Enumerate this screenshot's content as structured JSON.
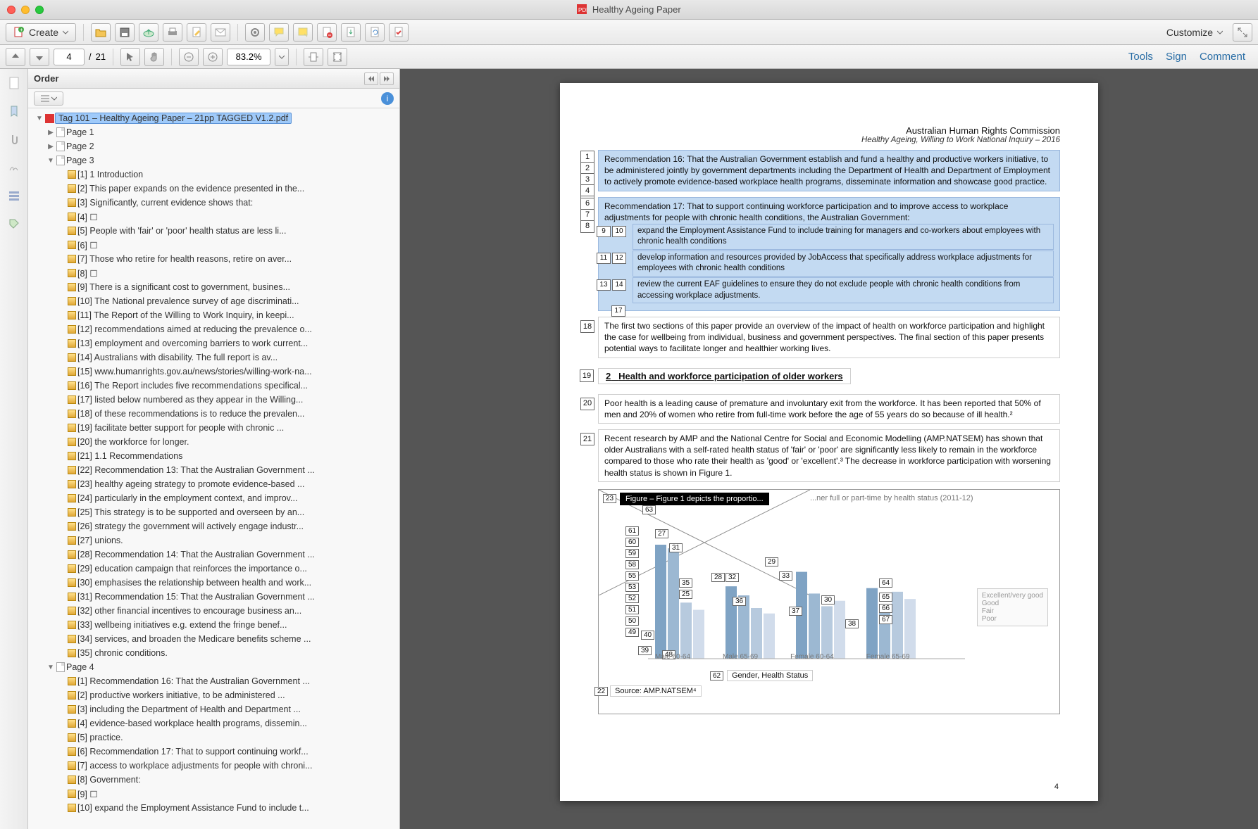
{
  "window_title": "Healthy Ageing Paper",
  "toolbar": {
    "create_label": "Create",
    "customize_label": "Customize"
  },
  "nav": {
    "page_current": "4",
    "page_sep": "/",
    "page_total": "21",
    "zoom": "83.2%",
    "tools": "Tools",
    "sign": "Sign",
    "comment": "Comment"
  },
  "order": {
    "title": "Order",
    "doc_name": "Tag 101 – Healthy Ageing Paper – 21pp TAGGED V1.2.pdf",
    "pages_simple": [
      "Page 1",
      "Page 2"
    ],
    "page3_label": "Page 3",
    "page3_items": [
      "[1]  1 Introduction",
      "[2]  This paper expands on the evidence presented in the...",
      "[3]  Significantly, current evidence shows that:",
      "[4]  ☐",
      "[5]  People with 'fair' or 'poor' health status are less li...",
      "[6]  ☐",
      "[7]  Those who retire for health reasons, retire on aver...",
      "[8]  ☐",
      "[9]  There is a significant cost to government, busines...",
      "[10]  The National prevalence survey of age discriminati...",
      "[11]  The Report of the Willing to Work Inquiry, in keepi...",
      "[12]  recommendations aimed at reducing the prevalence o...",
      "[13]  employment and overcoming barriers to work current...",
      "[14]  Australians with disability. The full report is av...",
      "[15]  www.humanrights.gov.au/news/stories/willing-work-na...",
      "[16]  The Report includes five recommendations specifical...",
      "[17]  listed below numbered as they appear in the Willing...",
      "[18]  of these recommendations is to reduce the prevalen...",
      "[19]  facilitate better support for people with chronic ...",
      "[20]  the workforce for longer.",
      "[21]  1.1 Recommendations",
      "[22]  Recommendation 13: That the Australian Government ...",
      "[23]  healthy ageing strategy to promote evidence-based ...",
      "[24]  particularly in the employment context, and improv...",
      "[25]  This strategy is to be supported and overseen by an...",
      "[26]  strategy the government will actively engage industr...",
      "[27]  unions.",
      "[28]  Recommendation 14: That the Australian Government ...",
      "[29]  education campaign that reinforces the importance o...",
      "[30]  emphasises the relationship between health and work...",
      "[31]  Recommendation 15: That the Australian Government ...",
      "[32]  other financial incentives to encourage business an...",
      "[33]  wellbeing initiatives e.g. extend the fringe benef...",
      "[34]  services, and broaden the Medicare benefits scheme ...",
      "[35]  chronic conditions."
    ],
    "page4_label": "Page 4",
    "page4_items": [
      "[1]  Recommendation 16: That the Australian Government ...",
      "[2]  productive workers initiative, to be administered ...",
      "[3]  including the Department of Health and Department ...",
      "[4]  evidence-based workplace health programs, dissemin...",
      "[5]  practice.",
      "[6]  Recommendation 17: That to support continuing workf...",
      "[7]  access to workplace adjustments for people with chroni...",
      "[8]  Government:",
      "[9]  ☐",
      "[10]  expand the Employment Assistance Fund to include t..."
    ]
  },
  "doc": {
    "header_title": "Australian Human Rights Commission",
    "header_sub": "Healthy Ageing, Willing to Work National Inquiry – 2016",
    "rec16": "Recommendation 16: That the Australian Government establish and fund a healthy and productive workers initiative, to be administered jointly by government departments including the Department of Health and Department of Employment to actively promote evidence-based workplace health programs, disseminate information and showcase good practice.",
    "rec17_main": "Recommendation 17: That to support continuing workforce participation and to improve access to workplace adjustments for people with chronic health conditions, the Australian Government:",
    "rec17_items": [
      "expand the Employment Assistance Fund to include training for managers and co-workers about employees with chronic health conditions",
      "develop information and resources provided by JobAccess that specifically address workplace adjustments for employees with chronic health conditions",
      "review the current EAF guidelines to ensure they do not exclude people with chronic health conditions from accessing workplace adjustments."
    ],
    "p18": "The first two sections of this paper provide an overview of the impact of health on workforce participation and highlight the case for wellbeing from individual, business and government perspectives. The final section of this paper presents potential ways to facilitate longer and healthier working lives.",
    "h2_text": "Health and workforce participation of older workers",
    "h2_num": "2",
    "p20": "Poor health is a leading cause of premature and involuntary exit from the workforce. It has been reported that 50% of men and 20% of women who retire from full-time work before the age of 55 years do so because of ill health.²",
    "p21": "Recent research by AMP and the National Centre for Social and Economic Modelling (AMP.NATSEM) has shown that older Australians with a self-rated health status of 'fair' or 'poor' are significantly less likely to remain in the workforce compared to those who rate their health as 'good' or 'excellent'.³ The decrease in workforce participation with worsening health status is shown in Figure 1.",
    "fig_caption": "Figure – Figure 1 depicts the proportio...",
    "fig_sub": "...ner full or part-time by health status (2011-12)",
    "fig_xlabel": "Gender, Health Status",
    "fig_source": "Source: AMP.NATSEM⁴",
    "legend": [
      "Excellent/very good",
      "Good",
      "Fair",
      "Poor"
    ],
    "x_categories": [
      "Male 60-64",
      "Male 65-69",
      "Female 60-64",
      "Female 65-69"
    ],
    "page_number": "4"
  },
  "chart_data": {
    "type": "bar",
    "title": "Proportion working full or part-time by health status (2011-12)",
    "x_categories": [
      "Male 60-64",
      "Male 65-69",
      "Female 60-64",
      "Female 65-69"
    ],
    "series": [
      {
        "name": "Excellent/very good",
        "values": [
          63,
          40,
          48,
          39
        ]
      },
      {
        "name": "Good",
        "values": [
          61,
          35,
          36,
          30
        ]
      },
      {
        "name": "Fair",
        "values": [
          31,
          28,
          29,
          37
        ]
      },
      {
        "name": "Poor",
        "values": [
          27,
          25,
          32,
          33
        ]
      }
    ],
    "ylim": [
      0,
      70
    ],
    "xlabel": "Gender, Health Status",
    "ylabel": "",
    "source": "AMP.NATSEM"
  }
}
